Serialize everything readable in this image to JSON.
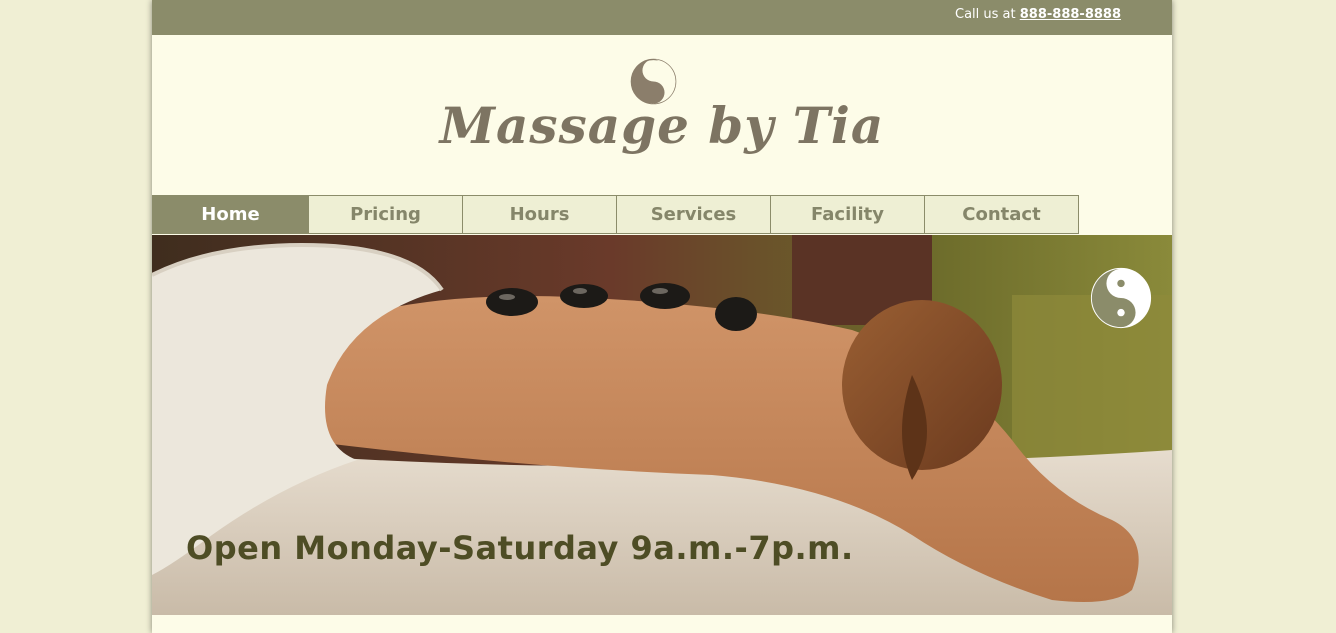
{
  "header": {
    "call_prefix": "Call us at",
    "phone": "888-888-8888",
    "logo_text": "Massage by Tia",
    "logo_icon": "yin-yang-icon"
  },
  "nav": {
    "items": [
      {
        "label": "Home",
        "active": true
      },
      {
        "label": "Pricing",
        "active": false
      },
      {
        "label": "Hours",
        "active": false
      },
      {
        "label": "Services",
        "active": false
      },
      {
        "label": "Facility",
        "active": false
      },
      {
        "label": "Contact",
        "active": false
      }
    ]
  },
  "hero": {
    "caption": "Open Monday-Saturday 9a.m.-7p.m.",
    "icon": "yin-yang-icon"
  },
  "colors": {
    "background": "#f0efd4",
    "page": "#fdfce8",
    "accent": "#8b8c6a",
    "logo": "#7d7462",
    "caption": "#4e4d25"
  }
}
